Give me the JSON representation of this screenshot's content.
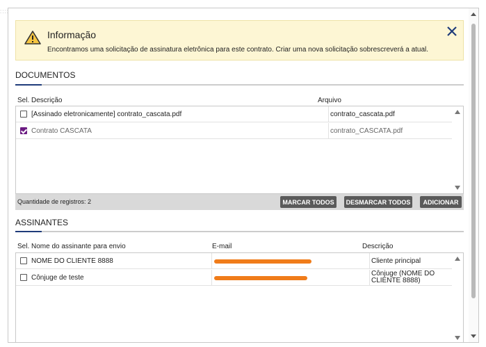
{
  "banner": {
    "title": "Informação",
    "message": "Encontramos uma solicitação de assinatura eletrônica para este contrato. Criar uma nova solicitação sobrescreverá a atual.",
    "bg_color": "#fdf6d4",
    "icon": "warning-icon",
    "close_icon": "close-icon"
  },
  "documentos": {
    "title": "DOCUMENTOS",
    "columns": {
      "sel": "Sel.",
      "descricao": "Descrição",
      "arquivo": "Arquivo"
    },
    "rows": [
      {
        "checked": false,
        "descricao": "[Assinado eletronicamente] contrato_cascata.pdf",
        "arquivo": "contrato_cascata.pdf"
      },
      {
        "checked": true,
        "descricao": "Contrato CASCATA",
        "arquivo": "contrato_CASCATA.pdf"
      }
    ],
    "footer": {
      "count_label": "Quantidade de registros: 2",
      "buttons": {
        "marcar": "MARCAR TODOS",
        "desmarcar": "DESMARCAR TODOS",
        "adicionar": "ADICIONAR"
      }
    }
  },
  "assinantes": {
    "title": "ASSINANTES",
    "columns": {
      "sel": "Sel.",
      "nome": "Nome do assinante para envio",
      "email": "E-mail",
      "descricao": "Descrição"
    },
    "rows": [
      {
        "checked": false,
        "nome": "NOME DO CLIENTE 8888",
        "email": "",
        "descricao": "Cliente principal"
      },
      {
        "checked": false,
        "nome": "Cônjuge de teste",
        "email": "",
        "descricao": "Cônjuge (NOME DO CLIENTE 8888)"
      }
    ]
  },
  "colors": {
    "accent": "#1f3b7a",
    "checkbox_checked": "#6b1b82",
    "button_bg": "#5a5a5a",
    "redaction": "#f07c1a"
  }
}
